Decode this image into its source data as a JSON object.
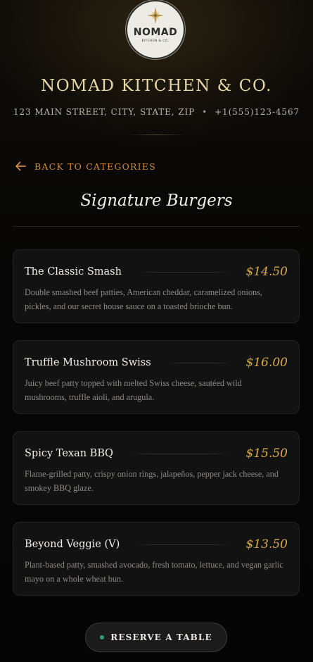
{
  "brand": {
    "logo_name": "NOMAD",
    "logo_sub": "KITCHEN & CO.",
    "title": "NOMAD KITCHEN & CO.",
    "address": "123 MAIN STREET, CITY, STATE, ZIP",
    "separator": "•",
    "phone": "+1(555)123-4567"
  },
  "nav": {
    "back_label": "BACK TO CATEGORIES",
    "back_icon": "arrow-left-icon"
  },
  "category": {
    "title": "Signature Burgers"
  },
  "items": [
    {
      "name": "The Classic Smash",
      "price": "$14.50",
      "description": "Double smashed beef patties, American cheddar, caramelized onions, pickles, and our secret house sauce on a toasted brioche bun."
    },
    {
      "name": "Truffle Mushroom Swiss",
      "price": "$16.00",
      "description": "Juicy beef patty topped with melted Swiss cheese, sautéed wild mushrooms, truffle aioli, and arugula."
    },
    {
      "name": "Spicy Texan BBQ",
      "price": "$15.50",
      "description": "Flame-grilled patty, crispy onion rings, jalapeños, pepper jack cheese, and smokey BBQ glaze."
    },
    {
      "name": "Beyond Veggie (V)",
      "price": "$13.50",
      "description": "Plant-based patty, smashed avocado, fresh tomato, lettuce, and vegan garlic mayo on a whole wheat bun."
    }
  ],
  "cta": {
    "reserve_label": "RESERVE A TABLE"
  },
  "colors": {
    "accent_gold": "#d9ac45",
    "accent_orange": "#d08a3a",
    "status_green": "#2f9e74",
    "background": "#060606"
  }
}
